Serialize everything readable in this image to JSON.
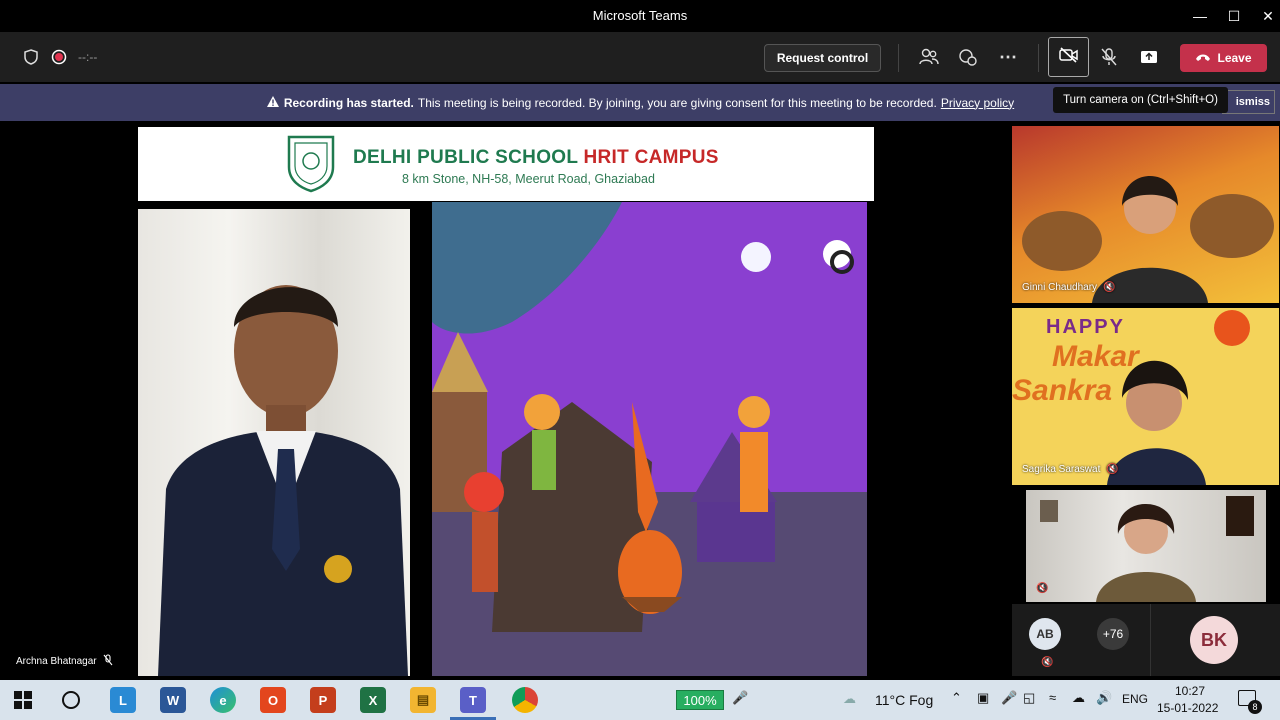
{
  "window": {
    "title": "Microsoft Teams"
  },
  "toolbar": {
    "timer": "--:--",
    "request_control": "Request control",
    "leave": "Leave"
  },
  "banner": {
    "bold": "Recording has started.",
    "text": "This meeting is being recorded. By joining, you are giving consent for this meeting to be recorded.",
    "link": "Privacy policy",
    "dismiss": "ismiss"
  },
  "tooltip": "Turn camera on (Ctrl+Shift+O)",
  "slide": {
    "school_name": "DELHI PUBLIC SCHOOL",
    "campus": "HRIT CAMPUS",
    "address": "8 km Stone, NH-58, Meerut Road, Ghaziabad"
  },
  "participants": {
    "presenter": "Archna Bhatnagar",
    "tiles": [
      {
        "name": "Ginni Chaudhary"
      },
      {
        "name": "Sagrika Saraswat",
        "poster_line1": "HAPPY",
        "poster_line2": "Makar",
        "poster_line3": "Sankra"
      }
    ],
    "avatars": {
      "ab": "AB",
      "more": "+76",
      "bk": "BK"
    }
  },
  "taskbar": {
    "battery": "100%",
    "weather": "11°C  Fog",
    "lang": "ENG",
    "time": "10:27",
    "date": "15-01-2022",
    "notif_count": "8"
  },
  "colors": {
    "leave": "#c4314b",
    "banner": "#3d3e66",
    "toolbar": "#1f1f1f",
    "school_green": "#1f7a4f",
    "school_red": "#c62828"
  }
}
